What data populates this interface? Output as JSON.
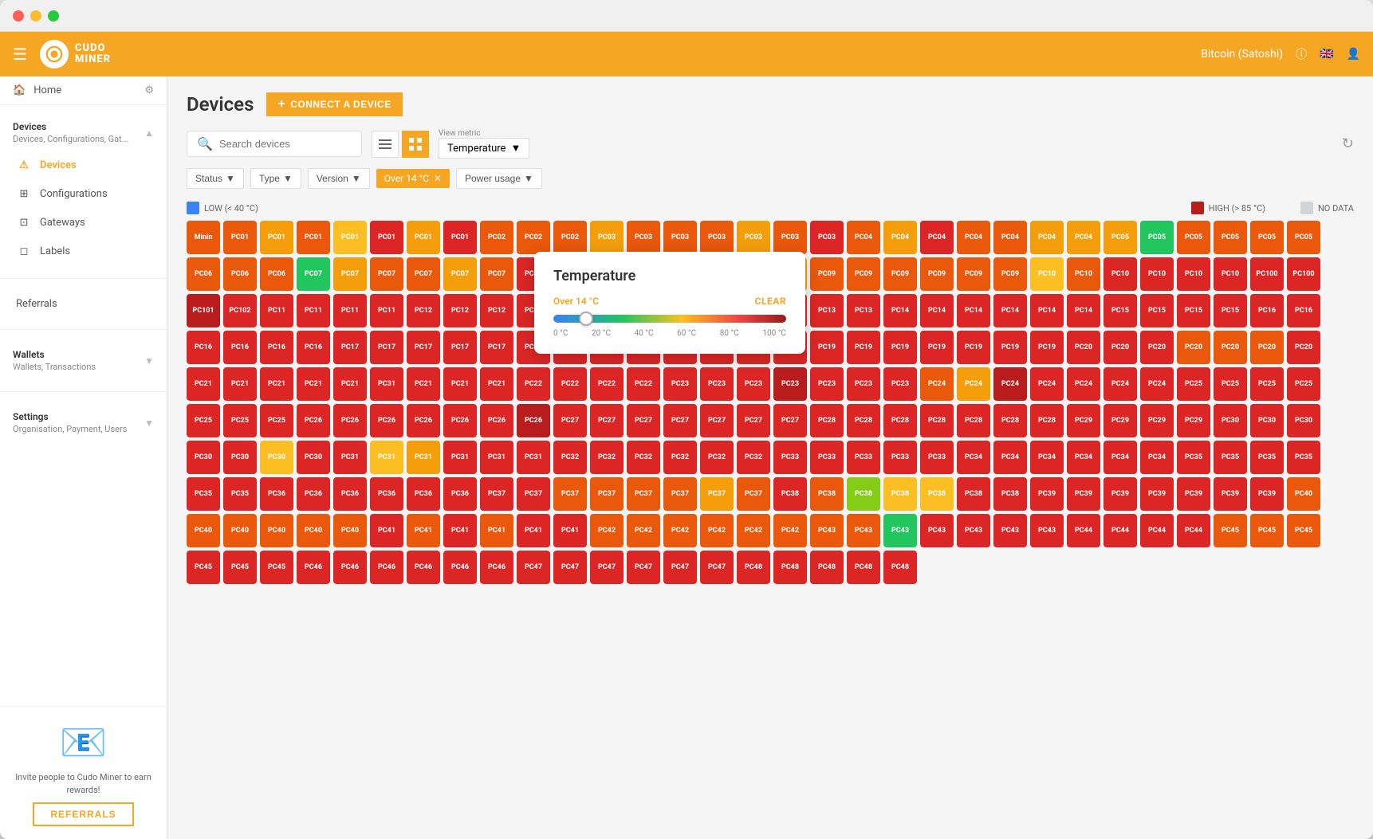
{
  "window": {
    "title": "Cudo Miner"
  },
  "topnav": {
    "logo_text": "CUDO\nMINER",
    "currency": "Bitcoin (Satoshi)"
  },
  "sidebar": {
    "home_label": "Home",
    "devices_section": {
      "title": "Devices",
      "subtitle": "Devices, Configurations, Gat...",
      "items": [
        {
          "id": "devices",
          "label": "Devices",
          "active": true
        },
        {
          "id": "configurations",
          "label": "Configurations",
          "active": false
        },
        {
          "id": "gateways",
          "label": "Gateways",
          "active": false
        },
        {
          "id": "labels",
          "label": "Labels",
          "active": false
        }
      ]
    },
    "referrals_label": "Referrals",
    "wallets_section": {
      "title": "Wallets",
      "subtitle": "Wallets, Transactions"
    },
    "settings_section": {
      "title": "Settings",
      "subtitle": "Organisation, Payment, Users"
    },
    "referral_box": {
      "text": "Invite people to Cudo Miner to earn rewards!",
      "button_label": "REFERRALS"
    }
  },
  "page": {
    "title": "Devices",
    "connect_button": "CONNECT A DEVICE",
    "search_placeholder": "Search devices",
    "view_metric_label": "View metric",
    "view_metric_value": "Temperature",
    "refresh_tooltip": "Refresh"
  },
  "filters": {
    "status": {
      "label": "Status",
      "active": false
    },
    "type": {
      "label": "Type",
      "active": false
    },
    "version": {
      "label": "Version",
      "active": false
    },
    "temp_filter": {
      "label": "Over 14 °C",
      "active": true
    },
    "power_usage": {
      "label": "Power usage",
      "active": false
    }
  },
  "legend": {
    "low_label": "LOW (< 40 °C)",
    "high_label": "HIGH (> 85 °C)",
    "no_data_label": "NO DATA"
  },
  "temp_popup": {
    "title": "Temperature",
    "filter_value": "Over 14 °C",
    "clear_label": "CLEAR",
    "slider_min": 0,
    "slider_max": 100,
    "slider_value": 14,
    "labels": [
      "0 °C",
      "20 °C",
      "40 °C",
      "60 °C",
      "80 °C",
      "100 °C"
    ]
  },
  "devices": {
    "colors": {
      "red_dark": "#b91c1c",
      "red": "#dc2626",
      "orange_dark": "#c2410c",
      "orange": "#ea580c",
      "orange_light": "#fb923c",
      "yellow": "#f59e0b",
      "yellow_green": "#84cc16",
      "green": "#22c55e",
      "blue": "#3b82f6",
      "no_data": "#d1d5db"
    }
  }
}
